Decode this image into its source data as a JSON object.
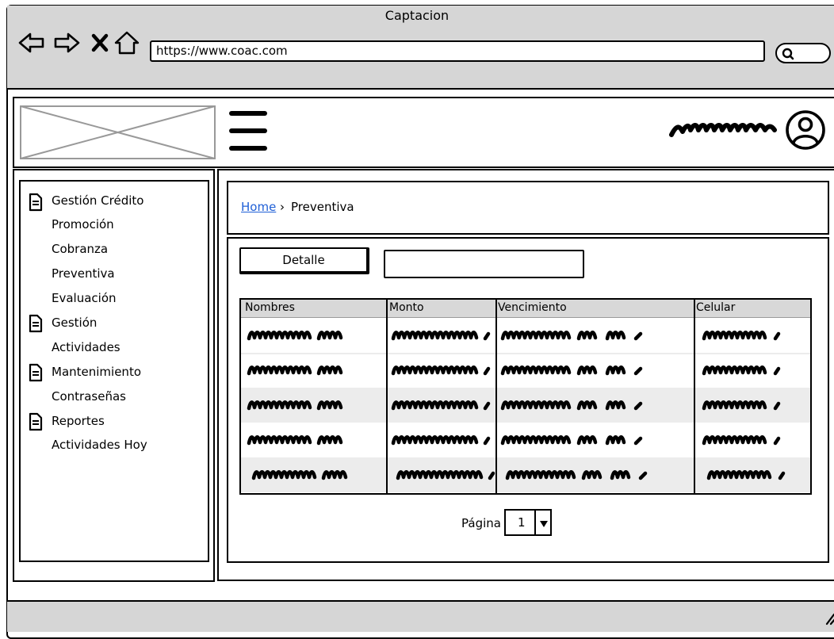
{
  "window": {
    "title": "Captacion",
    "url": "https://www.coac.com"
  },
  "browser_icons": [
    "back-arrow-icon",
    "forward-arrow-icon",
    "close-icon",
    "home-icon",
    "search-icon"
  ],
  "header": {
    "menu_icon": "hamburger-menu-icon",
    "user_icon": "user-avatar-icon",
    "user_name_scribble": "scribbled-user-name"
  },
  "sidebar": {
    "items": [
      {
        "label": "Gestión Crédito",
        "icon": "document-icon"
      },
      {
        "label": "Promoción"
      },
      {
        "label": "Cobranza"
      },
      {
        "label": "Preventiva"
      },
      {
        "label": "Evaluación"
      },
      {
        "label": "Gestión",
        "icon": "document-icon"
      },
      {
        "label": "Actividades"
      },
      {
        "label": "Mantenimiento",
        "icon": "document-icon"
      },
      {
        "label": "Contraseñas"
      },
      {
        "label": "Reportes",
        "icon": "document-icon"
      },
      {
        "label": "Actividades Hoy"
      }
    ]
  },
  "breadcrumb": {
    "home": "Home",
    "separator": "›",
    "current": "Preventiva"
  },
  "toolbar": {
    "detalle_label": "Detalle",
    "filter_value": ""
  },
  "table": {
    "columns": [
      "Nombres",
      "Monto",
      "Vencimiento",
      "Celular"
    ],
    "row_count": 5
  },
  "pager": {
    "label": "Página",
    "value": "1"
  },
  "colors": {
    "link": "#1f5fd6",
    "chrome": "#d6d6d6",
    "header_row": "#d8d8d8",
    "alt_row": "#ececec"
  }
}
